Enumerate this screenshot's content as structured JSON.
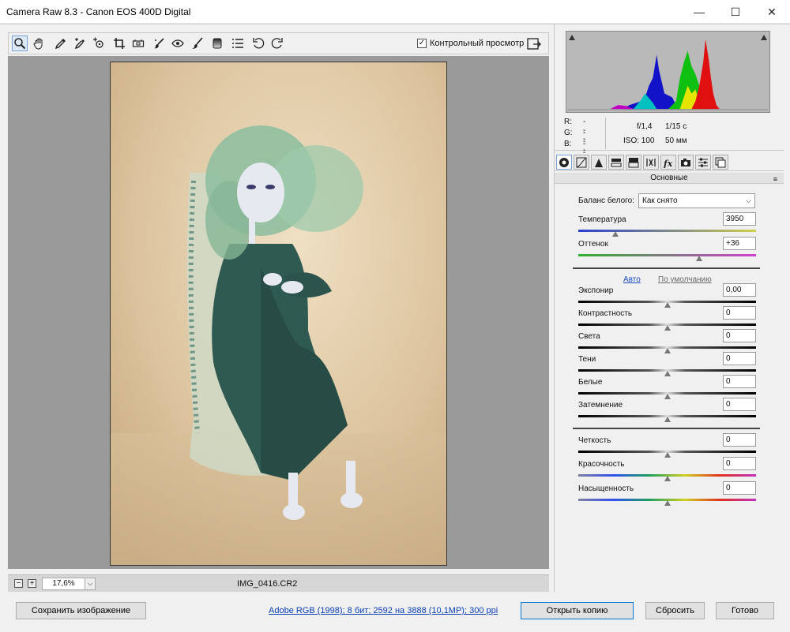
{
  "window": {
    "title": "Camera Raw 8.3  -  Canon EOS 400D Digital",
    "minimize_glyph": "—",
    "maximize_glyph": "☐",
    "close_glyph": "✕"
  },
  "toolbar": {
    "tools": [
      {
        "name": "zoom-tool",
        "icon": "magnifier-icon",
        "active": true
      },
      {
        "name": "hand-tool",
        "icon": "hand-icon"
      },
      {
        "name": "white-balance-tool",
        "icon": "eyedropper-icon"
      },
      {
        "name": "color-sampler-tool",
        "icon": "eyedropper-plus-icon"
      },
      {
        "name": "targeted-adjustment-tool",
        "icon": "target-icon"
      },
      {
        "name": "crop-tool",
        "icon": "crop-icon"
      },
      {
        "name": "straighten-tool",
        "icon": "level-icon"
      },
      {
        "name": "spot-removal-tool",
        "icon": "brush-heal-icon"
      },
      {
        "name": "red-eye-tool",
        "icon": "eye-icon"
      },
      {
        "name": "adjustment-brush-tool",
        "icon": "brush-icon"
      },
      {
        "name": "graduated-filter-tool",
        "icon": "gradient-icon"
      },
      {
        "name": "radial-filter-tool",
        "icon": "list-icon"
      },
      {
        "name": "rotate-left-tool",
        "icon": "rotate-ccw-icon"
      },
      {
        "name": "rotate-right-tool",
        "icon": "rotate-cw-icon"
      }
    ],
    "preview_label": "Контрольный просмотр",
    "preview_checked": true
  },
  "status": {
    "zoom_minus": "−",
    "zoom_plus": "+",
    "zoom_value": "17,6%",
    "zoom_caret": "⌵",
    "filename": "IMG_0416.CR2"
  },
  "info": {
    "r_label": "R:",
    "g_label": "G:",
    "b_label": "B:",
    "r_value": "---",
    "g_value": "---",
    "b_value": "---",
    "aperture": "f/1,4",
    "shutter": "1/15 с",
    "iso": "ISO: 100",
    "focal": "50 мм"
  },
  "panel": {
    "section_title": "Основные",
    "section_menu_glyph": "≡",
    "wb_label": "Баланс белого:",
    "wb_value": "Как снято",
    "wb_caret": "⌵",
    "auto_label": "Авто",
    "default_label": "По умолчанию",
    "sliders": [
      {
        "key": "temperature",
        "label": "Температура",
        "value": "3950",
        "pos": 0.21,
        "track": "temp"
      },
      {
        "key": "tint",
        "label": "Оттенок",
        "value": "+36",
        "pos": 0.68,
        "track": "tint"
      },
      {
        "key": "exposure",
        "label": "Экспонир",
        "value": "0,00",
        "pos": 0.5,
        "track": "gray"
      },
      {
        "key": "contrast",
        "label": "Контрастность",
        "value": "0",
        "pos": 0.5,
        "track": "gray"
      },
      {
        "key": "highlights",
        "label": "Света",
        "value": "0",
        "pos": 0.5,
        "track": "gray"
      },
      {
        "key": "shadows",
        "label": "Тени",
        "value": "0",
        "pos": 0.5,
        "track": "gray"
      },
      {
        "key": "whites",
        "label": "Белые",
        "value": "0",
        "pos": 0.5,
        "track": "gray"
      },
      {
        "key": "blacks",
        "label": "Затемнение",
        "value": "0",
        "pos": 0.5,
        "track": "gray"
      },
      {
        "key": "clarity",
        "label": "Четкость",
        "value": "0",
        "pos": 0.5,
        "track": "gray"
      },
      {
        "key": "vibrance",
        "label": "Красочность",
        "value": "0",
        "pos": 0.5,
        "track": "rainbow"
      },
      {
        "key": "saturation",
        "label": "Насыщенность",
        "value": "0",
        "pos": 0.5,
        "track": "rainbow"
      }
    ]
  },
  "footer": {
    "save_label": "Сохранить изображение",
    "workflow_label": "Adobe RGB (1998); 8 бит; 2592 на 3888 (10,1МР); 300 ppi",
    "open_copy_label": "Открыть копию",
    "reset_label": "Сбросить",
    "done_label": "Готово"
  }
}
